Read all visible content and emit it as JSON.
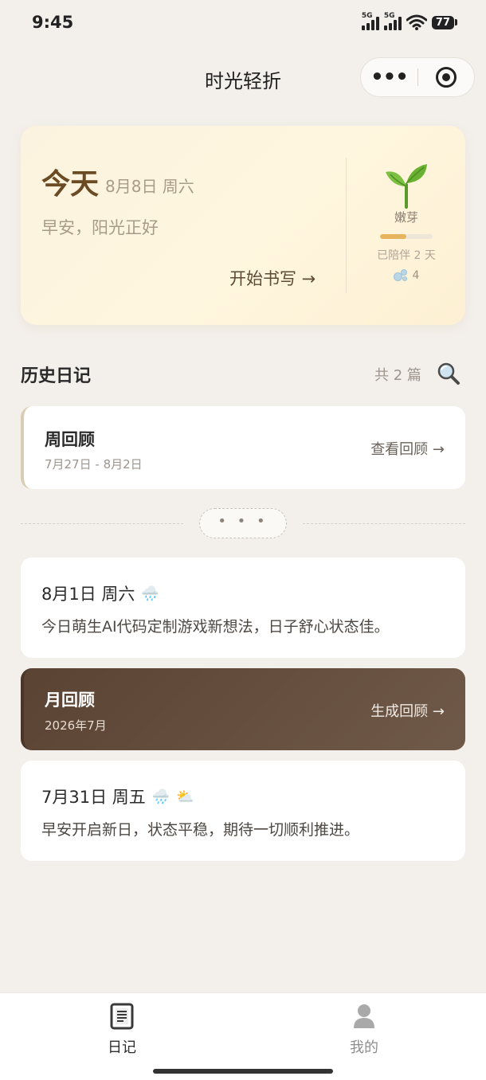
{
  "status_bar": {
    "time": "9:45",
    "signal1_label": "5G",
    "signal2_label": "5G",
    "battery": "77"
  },
  "nav": {
    "title": "时光轻折",
    "more_label": "•••"
  },
  "today": {
    "label": "今天",
    "date": "8月8日 周六",
    "greeting": "早安，阳光正好",
    "write_button": "开始书写 →",
    "plant_icon": "sprout-icon",
    "level_name": "嫩芽",
    "level_progress": 0.5,
    "companion_text": "已陪伴 2 天",
    "bubble_count": "4"
  },
  "history": {
    "title": "历史日记",
    "count": "共 2 篇",
    "weekly_review": {
      "title": "周回顾",
      "range": "7月27日 - 8月2日",
      "action": "查看回顾 →"
    },
    "fold_label": "• • •",
    "entries": [
      {
        "date": "8月1日 周六",
        "weather": [
          "🌧️"
        ],
        "text": "今日萌生AI代码定制游戏新想法，日子舒心状态佳。"
      },
      {
        "date": "7月31日 周五",
        "weather": [
          "🌧️",
          "⛅"
        ],
        "text": "早安开启新日，状态平稳，期待一切顺利推进。"
      }
    ],
    "monthly_review": {
      "title": "月回顾",
      "period": "2026年7月",
      "action": "生成回顾 →"
    }
  },
  "tabbar": {
    "tabs": [
      {
        "label": "日记",
        "icon": "diary-icon",
        "active": true
      },
      {
        "label": "我的",
        "icon": "profile-icon",
        "active": false
      }
    ]
  },
  "colors": {
    "background": "#f3efeb",
    "accent_brown": "#5b4333",
    "progress_fill": "#e6b45d"
  }
}
